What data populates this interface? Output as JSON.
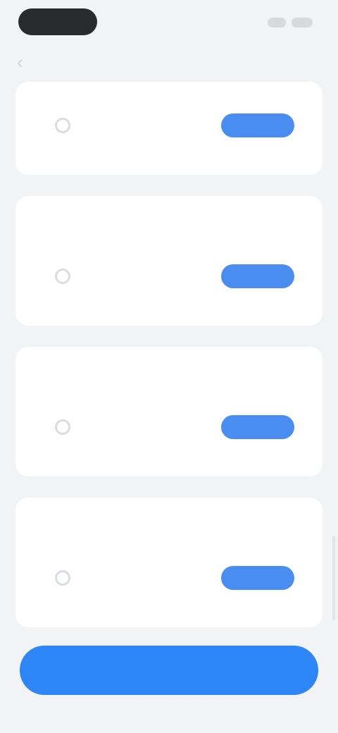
{
  "nav": {
    "title": "",
    "back_icon": "chevron-left-icon"
  },
  "sections": [
    {
      "label": "",
      "row": {
        "title": "",
        "subtitle": "",
        "button_label": ""
      }
    },
    {
      "label": "",
      "row": {
        "title": "",
        "subtitle": "",
        "button_label": ""
      }
    },
    {
      "label": "",
      "row": {
        "title": "",
        "subtitle": "",
        "button_label": ""
      }
    },
    {
      "label": "",
      "row": {
        "title": "",
        "subtitle": "",
        "button_label": ""
      }
    }
  ],
  "footer": {
    "primary_button_label": ""
  },
  "colors": {
    "accent": "#2e86f6",
    "pill": "#4a8df0",
    "background": "#f2f3f5",
    "card": "#ffffff"
  }
}
